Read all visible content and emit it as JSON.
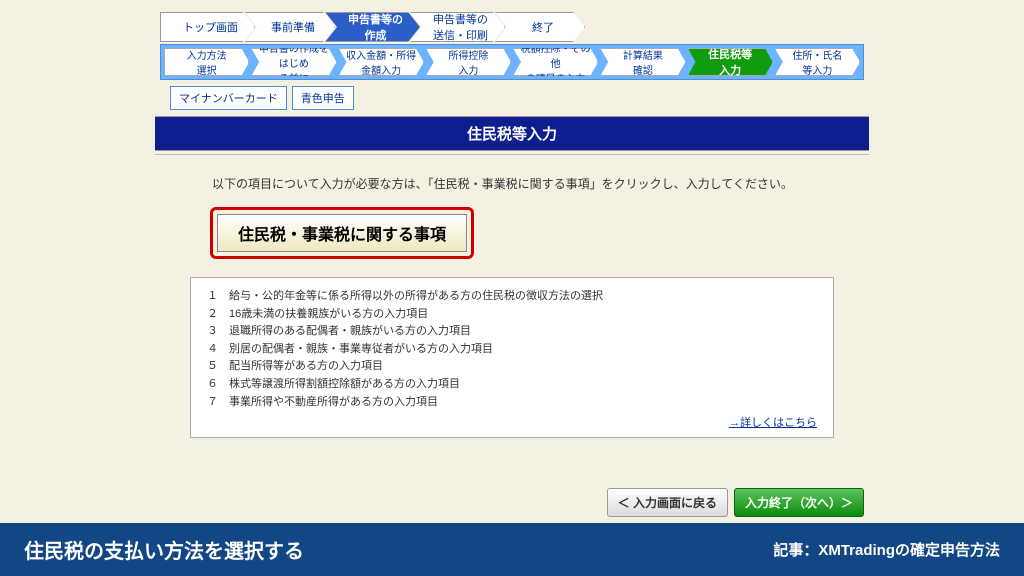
{
  "topNav": {
    "items": [
      "トップ画面",
      "事前準備",
      "申告書等の\n作成",
      "申告書等の\n送信・印刷",
      "終了"
    ],
    "activeIndex": 2
  },
  "subNav": {
    "items": [
      "入力方法\n選択",
      "申告書の作成をはじめ\nる前に",
      "収入金額・所得\n金額入力",
      "所得控除\n入力",
      "税額控除・その他\nの項目の入力",
      "計算結果\n確認",
      "住民税等\n入力",
      "住所・氏名\n等入力"
    ],
    "activeIndex": 6
  },
  "tags": [
    "マイナンバーカード",
    "青色申告"
  ],
  "title": "住民税等入力",
  "intro": "　以下の項目について入力が必要な方は、「住民税・事業税に関する事項」をクリックし、入力してください。",
  "mainButton": "住民税・事業税に関する事項",
  "listItems": [
    "１　給与・公的年金等に係る所得以外の所得がある方の住民税の徴収方法の選択",
    "２　16歳未満の扶養親族がいる方の入力項目",
    "３　退職所得のある配偶者・親族がいる方の入力項目",
    "４　別居の配偶者・親族・事業専従者がいる方の入力項目",
    "５　配当所得等がある方の入力項目",
    "６　株式等譲渡所得割額控除額がある方の入力項目",
    "７　事業所得や不動産所得がある方の入力項目"
  ],
  "detailLink": "→詳しくはこちら",
  "backButton": "＜ 入力画面に戻る",
  "nextButton": "入力終了（次へ）＞",
  "footer": {
    "title": "住民税の支払い方法を選択する",
    "article": "記事：XMTradingの確定申告方法"
  }
}
